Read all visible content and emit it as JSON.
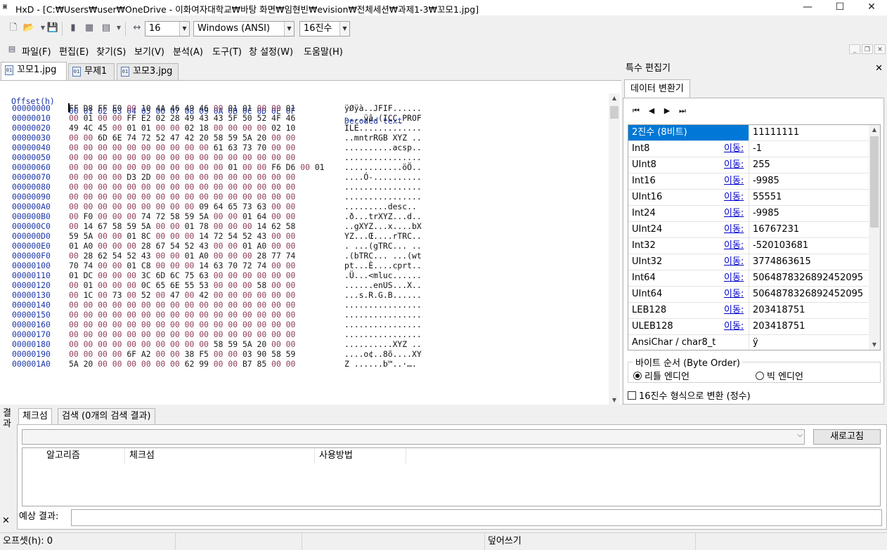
{
  "window": {
    "app_icon": "hex-editor-icon",
    "title": "HxD - [C:₩Users₩user₩OneDrive - 이화여자대학교₩바탕 화면₩임현빈₩evision₩전체세션₩과제1-3₩꼬모1.jpg]",
    "minimize": "—",
    "maximize": "☐",
    "close": "✕"
  },
  "toolbar": {
    "bytes_per_row": "16",
    "charset": "Windows (ANSI)",
    "display_mode": "16진수"
  },
  "menu": [
    "파일(F)",
    "편집(E)",
    "찾기(S)",
    "보기(V)",
    "분석(A)",
    "도구(T)",
    "창 설정(W)",
    "도움말(H)"
  ],
  "tabs": [
    "꼬모1.jpg",
    "무제1",
    "꼬모3.jpg"
  ],
  "hex_header": {
    "offset": "Offset(h)",
    "columns": "00 01 02 03 04 05 06 07 08 09 0A 0B 0C 0D 0E 0F",
    "decoded": "Decoded text"
  },
  "hex_rows": [
    {
      "o": "00000000",
      "b": "FF D8 FF E0 00 10 4A 46 49 46 00 01 01 00 00 01",
      "d": "ÿØÿà..JFIF......"
    },
    {
      "o": "00000010",
      "b": "00 01 00 00 FF E2 02 28 49 43 43 5F 50 52 4F 46",
      "d": "....ÿâ.(ICC_PROF"
    },
    {
      "o": "00000020",
      "b": "49 4C 45 00 01 01 00 00 02 18 00 00 00 00 02 10",
      "d": "ILE............."
    },
    {
      "o": "00000030",
      "b": "00 00 6D 6E 74 72 52 47 42 20 58 59 5A 20 00 00",
      "d": "..mntrRGB XYZ .."
    },
    {
      "o": "00000040",
      "b": "00 00 00 00 00 00 00 00 00 00 61 63 73 70 00 00",
      "d": "..........acsp.."
    },
    {
      "o": "00000050",
      "b": "00 00 00 00 00 00 00 00 00 00 00 00 00 00 00 00",
      "d": "................"
    },
    {
      "o": "00000060",
      "b": "00 00 00 00 00 00 00 00 00 00 00 01 00 00 F6 D6 00 01",
      "d": "............öÖ.."
    },
    {
      "o": "00000070",
      "b": "00 00 00 00 D3 2D 00 00 00 00 00 00 00 00 00 00",
      "d": "....Ó-.........."
    },
    {
      "o": "00000080",
      "b": "00 00 00 00 00 00 00 00 00 00 00 00 00 00 00 00",
      "d": "................"
    },
    {
      "o": "00000090",
      "b": "00 00 00 00 00 00 00 00 00 00 00 00 00 00 00 00",
      "d": "................"
    },
    {
      "o": "000000A0",
      "b": "00 00 00 00 00 00 00 00 00 09 64 65 73 63 00 00",
      "d": ".........desc.."
    },
    {
      "o": "000000B0",
      "b": "00 F0 00 00 00 74 72 58 59 5A 00 00 01 64 00 00",
      "d": ".ð...trXYZ...d.."
    },
    {
      "o": "000000C0",
      "b": "00 14 67 58 59 5A 00 00 01 78 00 00 00 14 62 58",
      "d": "..gXYZ...x....bX"
    },
    {
      "o": "000000D0",
      "b": "59 5A 00 00 01 8C 00 00 00 14 72 54 52 43 00 00",
      "d": "YZ...Œ....rTRC.."
    },
    {
      "o": "000000E0",
      "b": "01 A0 00 00 00 28 67 54 52 43 00 00 01 A0 00 00",
      "d": ". ...(gTRC... .."
    },
    {
      "o": "000000F0",
      "b": "00 28 62 54 52 43 00 00 01 A0 00 00 00 28 77 74",
      "d": ".(bTRC... ...(wt"
    },
    {
      "o": "00000100",
      "b": "70 74 00 00 01 C8 00 00 00 14 63 70 72 74 00 00",
      "d": "pt...È....cprt.."
    },
    {
      "o": "00000110",
      "b": "01 DC 00 00 00 3C 6D 6C 75 63 00 00 00 00 00 00",
      "d": ".Ü...<mluc......"
    },
    {
      "o": "00000120",
      "b": "00 01 00 00 00 0C 65 6E 55 53 00 00 00 58 00 00",
      "d": "......enUS...X.."
    },
    {
      "o": "00000130",
      "b": "00 1C 00 73 00 52 00 47 00 42 00 00 00 00 00 00",
      "d": "...s.R.G.B......"
    },
    {
      "o": "00000140",
      "b": "00 00 00 00 00 00 00 00 00 00 00 00 00 00 00 00",
      "d": "................"
    },
    {
      "o": "00000150",
      "b": "00 00 00 00 00 00 00 00 00 00 00 00 00 00 00 00",
      "d": "................"
    },
    {
      "o": "00000160",
      "b": "00 00 00 00 00 00 00 00 00 00 00 00 00 00 00 00",
      "d": "................"
    },
    {
      "o": "00000170",
      "b": "00 00 00 00 00 00 00 00 00 00 00 00 00 00 00 00",
      "d": "................"
    },
    {
      "o": "00000180",
      "b": "00 00 00 00 00 00 00 00 00 00 58 59 5A 20 00 00",
      "d": "..........XYZ .."
    },
    {
      "o": "00000190",
      "b": "00 00 00 00 6F A2 00 00 38 F5 00 00 03 90 58 59",
      "d": "....o¢..8õ....XY"
    },
    {
      "o": "000001A0",
      "b": "5A 20 00 00 00 00 00 00 62 99 00 00 B7 85 00 00",
      "d": "Z ......b™..·…."
    }
  ],
  "side_panel": {
    "title": "특수 편집기",
    "close": "✕",
    "tab": "데이터 변환기",
    "nav": [
      "⏮",
      "◀",
      "▶",
      "⏭"
    ],
    "go_label": "이동:",
    "rows": [
      {
        "name": "2진수 (8비트)",
        "value": "11111111",
        "go": false
      },
      {
        "name": "Int8",
        "value": "-1",
        "go": true
      },
      {
        "name": "UInt8",
        "value": "255",
        "go": true
      },
      {
        "name": "Int16",
        "value": "-9985",
        "go": true
      },
      {
        "name": "UInt16",
        "value": "55551",
        "go": true
      },
      {
        "name": "Int24",
        "value": "-9985",
        "go": true
      },
      {
        "name": "UInt24",
        "value": "16767231",
        "go": true
      },
      {
        "name": "Int32",
        "value": "-520103681",
        "go": true
      },
      {
        "name": "UInt32",
        "value": "3774863615",
        "go": true
      },
      {
        "name": "Int64",
        "value": "5064878326892452095",
        "go": true
      },
      {
        "name": "UInt64",
        "value": "5064878326892452095",
        "go": true
      },
      {
        "name": "LEB128",
        "value": "203418751",
        "go": true
      },
      {
        "name": "ULEB128",
        "value": "203418751",
        "go": true
      },
      {
        "name": "AnsiChar / char8_t",
        "value": "ÿ",
        "go": false
      }
    ],
    "byte_order_label": "바이트 순서 (Byte Order)",
    "little_endian": "리틀 엔디언",
    "big_endian": "빅 엔디언",
    "hex_checkbox": "16진수 형식으로 변환 (정수)"
  },
  "results": {
    "side_label": "결과",
    "side_close": "✕",
    "tabs": [
      "체크섬",
      "검색 (0개의 검색 결과)"
    ],
    "refresh": "새로고침",
    "columns": [
      "알고리즘",
      "체크섬",
      "사용방법"
    ],
    "expected_label": "예상 결과:"
  },
  "status": {
    "offset": "오프셋(h): 0",
    "mode": "덮어쓰기"
  }
}
